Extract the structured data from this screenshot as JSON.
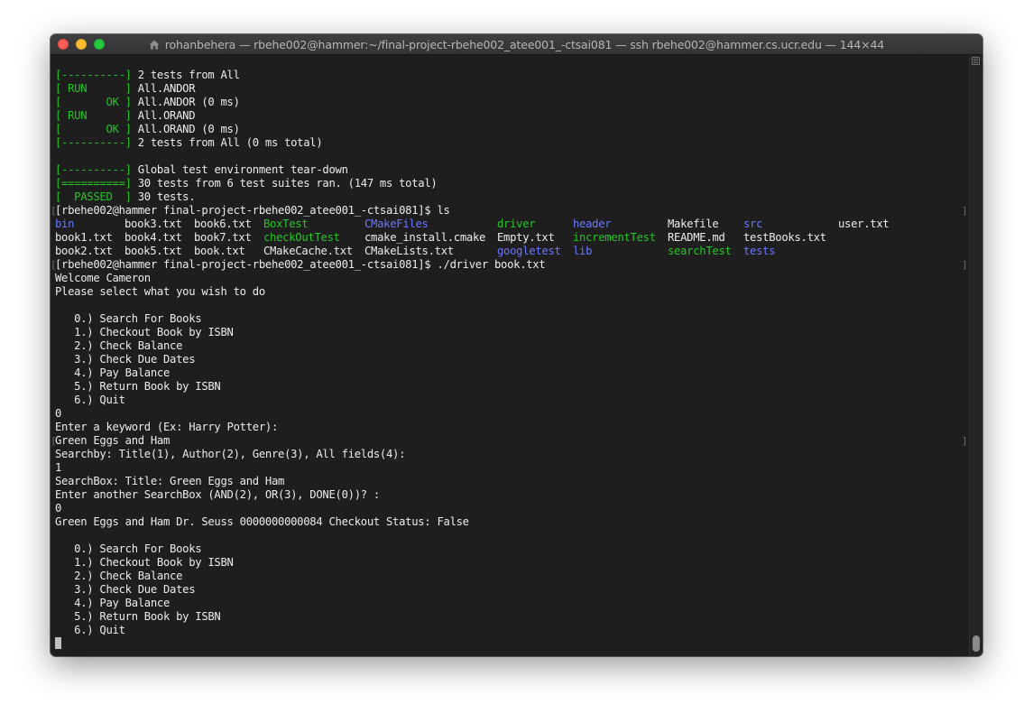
{
  "window": {
    "title": "rohanbehera — rbehe002@hammer:~/final-project-rbehe002_atee001_-ctsai081 — ssh rbehe002@hammer.cs.ucr.edu — 144×44"
  },
  "terminal": {
    "lines": [
      {
        "parts": [
          {
            "t": "[----------] ",
            "c": "g"
          },
          {
            "t": "2 tests from All",
            "c": "w"
          }
        ]
      },
      {
        "parts": [
          {
            "t": "[ RUN      ] ",
            "c": "g"
          },
          {
            "t": "All.ANDOR",
            "c": "w"
          }
        ]
      },
      {
        "parts": [
          {
            "t": "[       OK ] ",
            "c": "g"
          },
          {
            "t": "All.ANDOR (0 ms)",
            "c": "w"
          }
        ]
      },
      {
        "parts": [
          {
            "t": "[ RUN      ] ",
            "c": "g"
          },
          {
            "t": "All.ORAND",
            "c": "w"
          }
        ]
      },
      {
        "parts": [
          {
            "t": "[       OK ] ",
            "c": "g"
          },
          {
            "t": "All.ORAND (0 ms)",
            "c": "w"
          }
        ]
      },
      {
        "parts": [
          {
            "t": "[----------] ",
            "c": "g"
          },
          {
            "t": "2 tests from All (0 ms total)",
            "c": "w"
          }
        ]
      },
      {
        "parts": [
          {
            "t": "",
            "c": "w"
          }
        ]
      },
      {
        "parts": [
          {
            "t": "[----------] ",
            "c": "g"
          },
          {
            "t": "Global test environment tear-down",
            "c": "w"
          }
        ]
      },
      {
        "parts": [
          {
            "t": "[==========] ",
            "c": "g"
          },
          {
            "t": "30 tests from 6 test suites ran. (147 ms total)",
            "c": "w"
          }
        ]
      },
      {
        "parts": [
          {
            "t": "[  PASSED  ] ",
            "c": "g"
          },
          {
            "t": "30 tests.",
            "c": "w"
          }
        ]
      },
      {
        "prompt": true,
        "parts": [
          {
            "t": "[rbehe002@hammer final-project-rbehe002_atee001_-ctsai081]$ ls",
            "c": "w"
          }
        ]
      },
      {
        "ls": [
          {
            "t": "bin",
            "c": "b"
          },
          {
            "t": "book3.txt",
            "c": "w"
          },
          {
            "t": "book6.txt",
            "c": "w"
          },
          {
            "t": "BoxTest",
            "c": "g"
          },
          {
            "t": "CMakeFiles",
            "c": "b"
          },
          {
            "t": "driver",
            "c": "g"
          },
          {
            "t": "header",
            "c": "b"
          },
          {
            "t": "Makefile",
            "c": "w"
          },
          {
            "t": "src",
            "c": "b"
          },
          {
            "t": "user.txt",
            "c": "w"
          }
        ]
      },
      {
        "ls": [
          {
            "t": "book1.txt",
            "c": "w"
          },
          {
            "t": "book4.txt",
            "c": "w"
          },
          {
            "t": "book7.txt",
            "c": "w"
          },
          {
            "t": "checkOutTest",
            "c": "g"
          },
          {
            "t": "cmake_install.cmake",
            "c": "w"
          },
          {
            "t": "Empty.txt",
            "c": "w"
          },
          {
            "t": "incrementTest",
            "c": "g"
          },
          {
            "t": "README.md",
            "c": "w"
          },
          {
            "t": "testBooks.txt",
            "c": "w"
          },
          {
            "t": "",
            "c": "w"
          }
        ]
      },
      {
        "ls": [
          {
            "t": "book2.txt",
            "c": "w"
          },
          {
            "t": "book5.txt",
            "c": "w"
          },
          {
            "t": "book.txt",
            "c": "w"
          },
          {
            "t": "CMakeCache.txt",
            "c": "w"
          },
          {
            "t": "CMakeLists.txt",
            "c": "w"
          },
          {
            "t": "googletest",
            "c": "b"
          },
          {
            "t": "lib",
            "c": "b"
          },
          {
            "t": "searchTest",
            "c": "g"
          },
          {
            "t": "tests",
            "c": "b"
          },
          {
            "t": "",
            "c": "w"
          }
        ]
      },
      {
        "prompt": true,
        "parts": [
          {
            "t": "[rbehe002@hammer final-project-rbehe002_atee001_-ctsai081]$ ./driver book.txt",
            "c": "w"
          }
        ]
      },
      {
        "parts": [
          {
            "t": "Welcome Cameron",
            "c": "w"
          }
        ]
      },
      {
        "parts": [
          {
            "t": "Please select what you wish to do",
            "c": "w"
          }
        ]
      },
      {
        "parts": [
          {
            "t": "",
            "c": "w"
          }
        ]
      },
      {
        "parts": [
          {
            "t": "   0.) Search For Books",
            "c": "w"
          }
        ]
      },
      {
        "parts": [
          {
            "t": "   1.) Checkout Book by ISBN",
            "c": "w"
          }
        ]
      },
      {
        "parts": [
          {
            "t": "   2.) Check Balance",
            "c": "w"
          }
        ]
      },
      {
        "parts": [
          {
            "t": "   3.) Check Due Dates",
            "c": "w"
          }
        ]
      },
      {
        "parts": [
          {
            "t": "   4.) Pay Balance",
            "c": "w"
          }
        ]
      },
      {
        "parts": [
          {
            "t": "   5.) Return Book by ISBN",
            "c": "w"
          }
        ]
      },
      {
        "parts": [
          {
            "t": "   6.) Quit",
            "c": "w"
          }
        ]
      },
      {
        "parts": [
          {
            "t": "0",
            "c": "w"
          }
        ]
      },
      {
        "parts": [
          {
            "t": "Enter a keyword (Ex: Harry Potter):",
            "c": "w"
          }
        ]
      },
      {
        "prompt": true,
        "parts": [
          {
            "t": "Green Eggs and Ham",
            "c": "w"
          }
        ]
      },
      {
        "parts": [
          {
            "t": "Searchby: Title(1), Author(2), Genre(3), All fields(4):",
            "c": "w"
          }
        ]
      },
      {
        "parts": [
          {
            "t": "1",
            "c": "w"
          }
        ]
      },
      {
        "parts": [
          {
            "t": "SearchBox: Title: Green Eggs and Ham",
            "c": "w"
          }
        ]
      },
      {
        "parts": [
          {
            "t": "Enter another SearchBox (AND(2), OR(3), DONE(0))? :",
            "c": "w"
          }
        ]
      },
      {
        "parts": [
          {
            "t": "0",
            "c": "w"
          }
        ]
      },
      {
        "parts": [
          {
            "t": "Green Eggs and Ham Dr. Seuss 0000000000084 Checkout Status: False",
            "c": "w"
          }
        ]
      },
      {
        "parts": [
          {
            "t": "",
            "c": "w"
          }
        ]
      },
      {
        "parts": [
          {
            "t": "   0.) Search For Books",
            "c": "w"
          }
        ]
      },
      {
        "parts": [
          {
            "t": "   1.) Checkout Book by ISBN",
            "c": "w"
          }
        ]
      },
      {
        "parts": [
          {
            "t": "   2.) Check Balance",
            "c": "w"
          }
        ]
      },
      {
        "parts": [
          {
            "t": "   3.) Check Due Dates",
            "c": "w"
          }
        ]
      },
      {
        "parts": [
          {
            "t": "   4.) Pay Balance",
            "c": "w"
          }
        ]
      },
      {
        "parts": [
          {
            "t": "   5.) Return Book by ISBN",
            "c": "w"
          }
        ]
      },
      {
        "parts": [
          {
            "t": "   6.) Quit",
            "c": "w"
          }
        ]
      },
      {
        "cursor": true,
        "parts": []
      }
    ]
  },
  "colors": {
    "background": "#1e1e1e",
    "text": "#ececec",
    "green": "#26c526",
    "blue": "#6b77ff"
  }
}
